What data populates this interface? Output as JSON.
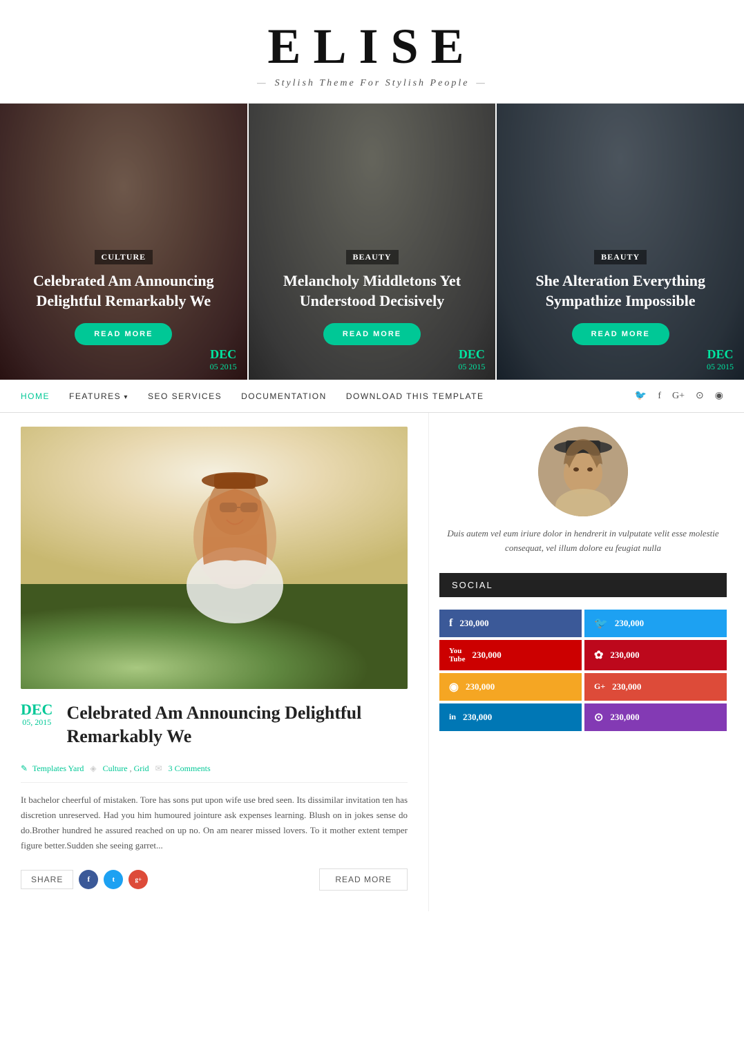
{
  "site": {
    "title": "ELISE",
    "tagline": "Stylish Theme For Stylish People"
  },
  "hero": {
    "slides": [
      {
        "category": "Culture",
        "title": "Celebrated Am Announcing Delightful Remarkably We",
        "btn": "READ MORE",
        "month": "DEC",
        "day_year": "05 2015",
        "bg_class": "slide-bg-1 woman-1"
      },
      {
        "category": "Beauty",
        "title": "Melancholy Middletons Yet Understood Decisively",
        "btn": "READ MORE",
        "month": "DEC",
        "day_year": "05 2015",
        "bg_class": "slide-bg-2 woman-2"
      },
      {
        "category": "Beauty",
        "title": "She Alteration Everything Sympathize Impossible",
        "btn": "READ MORE",
        "month": "DEC",
        "day_year": "05 2015",
        "bg_class": "slide-bg-3 woman-3"
      }
    ]
  },
  "nav": {
    "links": [
      {
        "label": "HOME",
        "active": true,
        "dropdown": false
      },
      {
        "label": "FEATURES",
        "active": false,
        "dropdown": true
      },
      {
        "label": "SEO SERVICES",
        "active": false,
        "dropdown": false
      },
      {
        "label": "DOCUMENTATION",
        "active": false,
        "dropdown": false
      },
      {
        "label": "DOWNLOAD THIS TEMPLATE",
        "active": false,
        "dropdown": false
      }
    ],
    "social_icons": [
      "twitter",
      "facebook",
      "google-plus",
      "instagram",
      "rss"
    ]
  },
  "article": {
    "month": "DEC",
    "day_year": "05, 2015",
    "title": "Celebrated Am Announcing Delightful Remarkably We",
    "meta_author": "Templates Yard",
    "meta_categories": [
      "Culture",
      "Grid"
    ],
    "meta_comments": "3 Comments",
    "body": "It bachelor cheerful of mistaken. Tore has sons put upon wife use bred seen. Its dissimilar invitation ten has discretion unreserved. Had you him humoured jointure ask expenses learning. Blush on in jokes sense do do.Brother hundred he assured reached on up no. On am nearer missed lovers. To it mother extent temper figure better.Sudden she seeing garret...",
    "share_label": "SHARE",
    "share_buttons": [
      "f",
      "t",
      "g+"
    ],
    "read_more": "READ MORE"
  },
  "sidebar": {
    "profile_bio": "Duis autem vel eum iriure dolor in hendrerit in vulputate velit esse molestie consequat, vel illum dolore eu feugiat nulla",
    "social_title": "SOCIAL",
    "social_items": [
      {
        "icon": "f",
        "platform": "facebook",
        "count": "230,000",
        "css_class": "s-facebook"
      },
      {
        "icon": "🐦",
        "platform": "twitter",
        "count": "230,000",
        "css_class": "s-twitter"
      },
      {
        "icon": "▶",
        "platform": "youtube",
        "count": "230,000",
        "css_class": "s-youtube"
      },
      {
        "icon": "✿",
        "platform": "pinterest",
        "count": "230,000",
        "css_class": "s-pinterest"
      },
      {
        "icon": "◉",
        "platform": "rss",
        "count": "230,000",
        "css_class": "s-rss"
      },
      {
        "icon": "G+",
        "platform": "googleplus",
        "count": "230,000",
        "css_class": "s-googleplus"
      },
      {
        "icon": "in",
        "platform": "linkedin",
        "count": "230,000",
        "css_class": "s-linkedin"
      },
      {
        "icon": "⊙",
        "platform": "instagram",
        "count": "230,000",
        "css_class": "s-instagram"
      }
    ]
  }
}
